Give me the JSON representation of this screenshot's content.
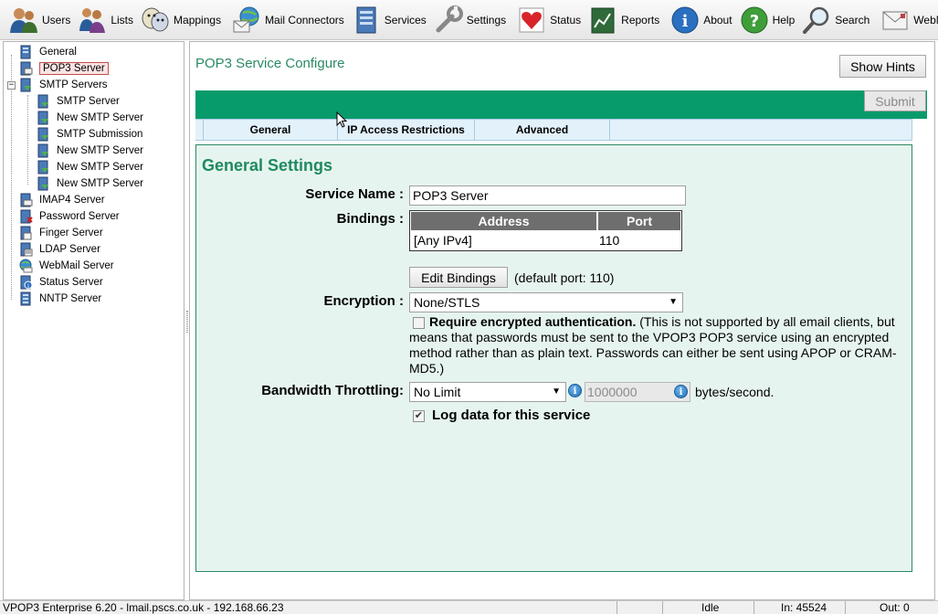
{
  "toolbar": {
    "items": [
      {
        "label": "Users",
        "icon": "users-icon"
      },
      {
        "label": "Lists",
        "icon": "lists-icon"
      },
      {
        "label": "Mappings",
        "icon": "mappings-icon"
      },
      {
        "label": "Mail Connectors",
        "icon": "mail-connectors-icon"
      },
      {
        "label": "Services",
        "icon": "services-icon"
      },
      {
        "label": "Settings",
        "icon": "settings-icon"
      },
      {
        "label": "Status",
        "icon": "status-icon"
      },
      {
        "label": "Reports",
        "icon": "reports-icon"
      },
      {
        "label": "About",
        "icon": "about-icon"
      },
      {
        "label": "Help",
        "icon": "help-icon"
      },
      {
        "label": "Search",
        "icon": "search-icon"
      },
      {
        "label": "WebMail",
        "icon": "webmail-icon"
      }
    ]
  },
  "tree": {
    "items": [
      {
        "label": "General",
        "icon": "server-icon"
      },
      {
        "label": "POP3 Server",
        "icon": "pop3-server-icon",
        "selected": true
      },
      {
        "label": "SMTP Servers",
        "icon": "smtp-servers-icon",
        "expanded": true
      },
      {
        "label": "SMTP Server",
        "icon": "smtp-server-icon"
      },
      {
        "label": "New SMTP Server",
        "icon": "smtp-server-icon"
      },
      {
        "label": "SMTP Submission",
        "icon": "smtp-server-icon"
      },
      {
        "label": "New SMTP Server",
        "icon": "smtp-server-icon"
      },
      {
        "label": "New SMTP Server",
        "icon": "smtp-server-icon"
      },
      {
        "label": "New SMTP Server",
        "icon": "smtp-server-icon"
      },
      {
        "label": "IMAP4 Server",
        "icon": "imap4-server-icon"
      },
      {
        "label": "Password Server",
        "icon": "password-server-icon"
      },
      {
        "label": "Finger Server",
        "icon": "finger-server-icon"
      },
      {
        "label": "LDAP Server",
        "icon": "ldap-server-icon"
      },
      {
        "label": "WebMail Server",
        "icon": "webmail-server-icon"
      },
      {
        "label": "Status Server",
        "icon": "status-server-icon"
      },
      {
        "label": "NNTP Server",
        "icon": "nntp-server-icon"
      }
    ],
    "toggle_symbol": "−"
  },
  "main": {
    "page_title": "POP3 Service Configure",
    "show_hints_label": "Show Hints",
    "submit_label": "Submit",
    "tabs": [
      {
        "label": "General",
        "active": true
      },
      {
        "label": "IP Access Restrictions",
        "active": false
      },
      {
        "label": "Advanced",
        "active": false
      }
    ],
    "section_title": "General Settings",
    "service_name": {
      "label": "Service Name :",
      "value": "POP3 Server"
    },
    "bindings": {
      "label": "Bindings :",
      "columns": [
        "Address",
        "Port"
      ],
      "rows": [
        {
          "address": "[Any IPv4]",
          "port": "110"
        }
      ],
      "edit_label": "Edit Bindings",
      "default_port_text": "(default port: 110)"
    },
    "encryption": {
      "label": "Encryption :",
      "value": "None/STLS"
    },
    "require_auth": {
      "checked": false,
      "label": "Require encrypted authentication.",
      "description": " (This is not supported by all email clients, but means that passwords must be sent to the VPOP3 POP3 service using an encrypted method rather than as plain text. Passwords can either be sent using APOP or CRAM-MD5.)"
    },
    "bandwidth": {
      "label": "Bandwidth Throttling:",
      "select_value": "No Limit",
      "value": "1000000",
      "unit": "bytes/second."
    },
    "log_data": {
      "checked": true,
      "label": "Log data for this service"
    }
  },
  "status_bar": {
    "info": "VPOP3 Enterprise 6.20 - lmail.pscs.co.uk - 192.168.66.23",
    "state": "Idle",
    "in": "In: 45524",
    "out": "Out: 0"
  },
  "colors": {
    "accent_green": "#079a6b",
    "title_green": "#2a8a63",
    "content_bg": "#e6f4ef",
    "tab_bg": "#e3f1fa"
  }
}
